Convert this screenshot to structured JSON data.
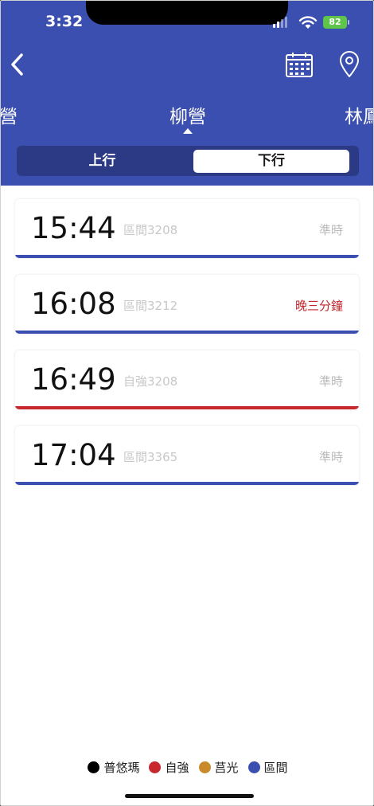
{
  "status_bar": {
    "time": "3:32",
    "battery": "82"
  },
  "nav": {
    "prev_station": "營",
    "current_station": "柳營",
    "next_station": "林鳳"
  },
  "direction": {
    "up_label": "上行",
    "down_label": "下行",
    "selected": "下行"
  },
  "trains": [
    {
      "time": "15:44",
      "code": "區間3208",
      "status": "準時",
      "bar_color": "#3b4fb0",
      "status_color": "#b9b9b9"
    },
    {
      "time": "16:08",
      "code": "區間3212",
      "status": "晚三分鐘",
      "bar_color": "#3b4fb0",
      "status_color": "#c0282d"
    },
    {
      "time": "16:49",
      "code": "自強3208",
      "status": "準時",
      "bar_color": "#c8282d",
      "status_color": "#b9b9b9"
    },
    {
      "time": "17:04",
      "code": "區間3365",
      "status": "準時",
      "bar_color": "#3b4fb0",
      "status_color": "#b9b9b9"
    }
  ],
  "legend": [
    {
      "label": "普悠瑪",
      "color": "#000000"
    },
    {
      "label": "自強",
      "color": "#c8282d"
    },
    {
      "label": "莒光",
      "color": "#c88a2a"
    },
    {
      "label": "區間",
      "color": "#3b4fb0"
    }
  ]
}
